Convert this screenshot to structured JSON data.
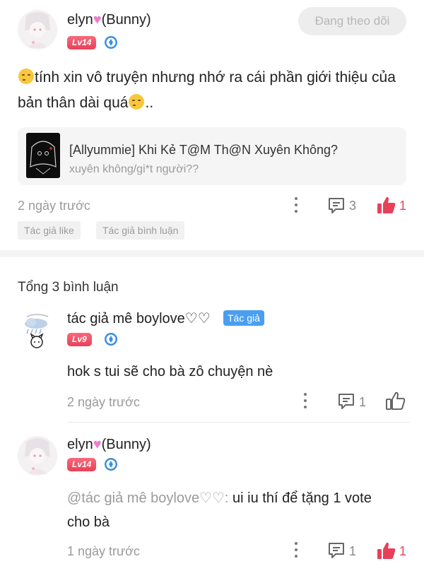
{
  "post": {
    "username": "elyn",
    "username_suffix": "(Bunny)",
    "level": "Lv14",
    "follow_label": "Đang theo dõi",
    "text_part1": "tính xin vô truyện nhưng nhớ ra cái phần giới thiệu của bản thân dài quá",
    "text_part2": "..",
    "story_title": "[Allyummie] Khi Kẻ T@M Th@N Xuyên Không?",
    "story_tags": "xuyên không/gi*t người??",
    "time": "2 ngày trước",
    "comment_count": "3",
    "like_count": "1",
    "tags": [
      "Tác giả like",
      "Tác giả bình luận"
    ]
  },
  "comments_header": "Tổng 3 bình luận",
  "comments": [
    {
      "username": "tác giả mê boylove♡♡",
      "author_badge": "Tác giả",
      "level": "Lv9",
      "text": "hok s tui sẽ cho bà zô chuyện nè",
      "time": "2 ngày trước",
      "reply_count": "1"
    },
    {
      "username": "elyn",
      "username_suffix": "(Bunny)",
      "level": "Lv14",
      "mention": "@tác giả mê boylove♡♡:",
      "text_line1": " ui iu thí để tặng 1 vote",
      "text_line2": "cho bà",
      "time": "1 ngày trước",
      "reply_count": "1",
      "like_count": "1"
    }
  ],
  "colors": {
    "accent_like": "#e8405a",
    "level_badge": "#f0566e",
    "author_badge": "#4a9ef0",
    "muted_text": "#9b9b9b"
  }
}
